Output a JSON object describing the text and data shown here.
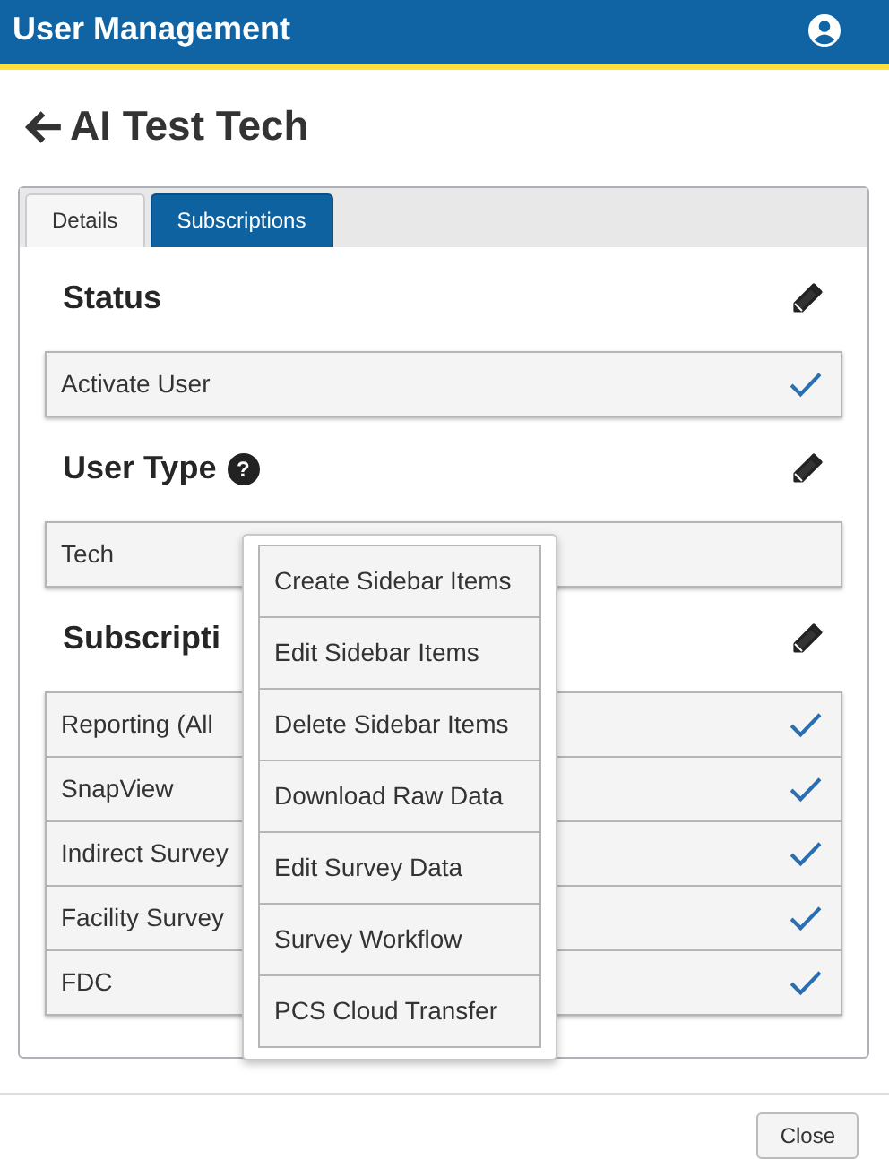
{
  "header": {
    "title": "User Management"
  },
  "page": {
    "title": "AI Test Tech"
  },
  "tabs": [
    {
      "label": "Details",
      "selected": false
    },
    {
      "label": "Subscriptions",
      "selected": true
    }
  ],
  "sections": [
    {
      "title": "Status",
      "rows": [
        {
          "label": "Activate User",
          "checked": true
        }
      ]
    },
    {
      "title": "User Type",
      "help_icon": "?",
      "rows": [
        {
          "label": "Tech",
          "checked": false
        }
      ]
    },
    {
      "title": "Subscripti",
      "rows": [
        {
          "label": "Reporting (All",
          "checked": true
        },
        {
          "label": "SnapView",
          "checked": true
        },
        {
          "label": "Indirect Survey",
          "checked": true
        },
        {
          "label": "Facility Survey",
          "checked": true
        },
        {
          "label": "FDC",
          "checked": true
        }
      ]
    }
  ],
  "popup_menu": [
    "Create Sidebar Items",
    "Edit Sidebar Items",
    "Delete Sidebar Items",
    "Download Raw Data",
    "Edit Survey Data",
    "Survey Workflow",
    "PCS Cloud Transfer"
  ],
  "footer": {
    "close_button": "Close"
  }
}
